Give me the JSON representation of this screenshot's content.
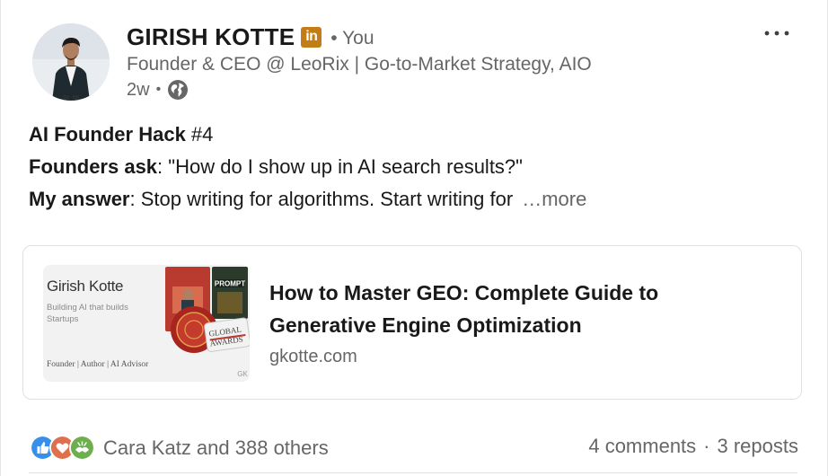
{
  "author": {
    "name": "GIRISH KOTTE",
    "badge": "in",
    "relation": "• You",
    "headline": "Founder & CEO @ LeoRix | Go-to-Market Strategy, AIO",
    "time": "2w",
    "visibility_icon": "globe-icon"
  },
  "menu": {
    "icon": "more-horizontal-icon",
    "label": "•••"
  },
  "post": {
    "line1_bold": "AI Founder Hack",
    "line1_rest": " #4",
    "line2_bold": "Founders ask",
    "line2_rest": ": \"How do I show up in AI search results?\"",
    "line3_bold": "My answer",
    "line3_rest": ": Stop writing for algorithms. Start writing for",
    "more": "…more"
  },
  "link_preview": {
    "thumbnail": {
      "name": "Girish Kotte",
      "tagline": "Building AI that builds Startups",
      "footer": "Founder | Author | AI Advisor",
      "book_label": "PROMPT",
      "award_label": "GLOBAL AWARDS"
    },
    "title": "How to Master GEO: Complete Guide to Generative Engine Optimization",
    "domain": "gkotte.com"
  },
  "social": {
    "reactors": "Cara Katz and 388 others",
    "comments": "4 comments",
    "separator": "·",
    "reposts": "3 reposts",
    "colors": {
      "like": "#378fe9",
      "love": "#df704d",
      "support": "#6dae4f",
      "linkedin_gold": "#c37d16",
      "muted_text": "#666666"
    }
  }
}
